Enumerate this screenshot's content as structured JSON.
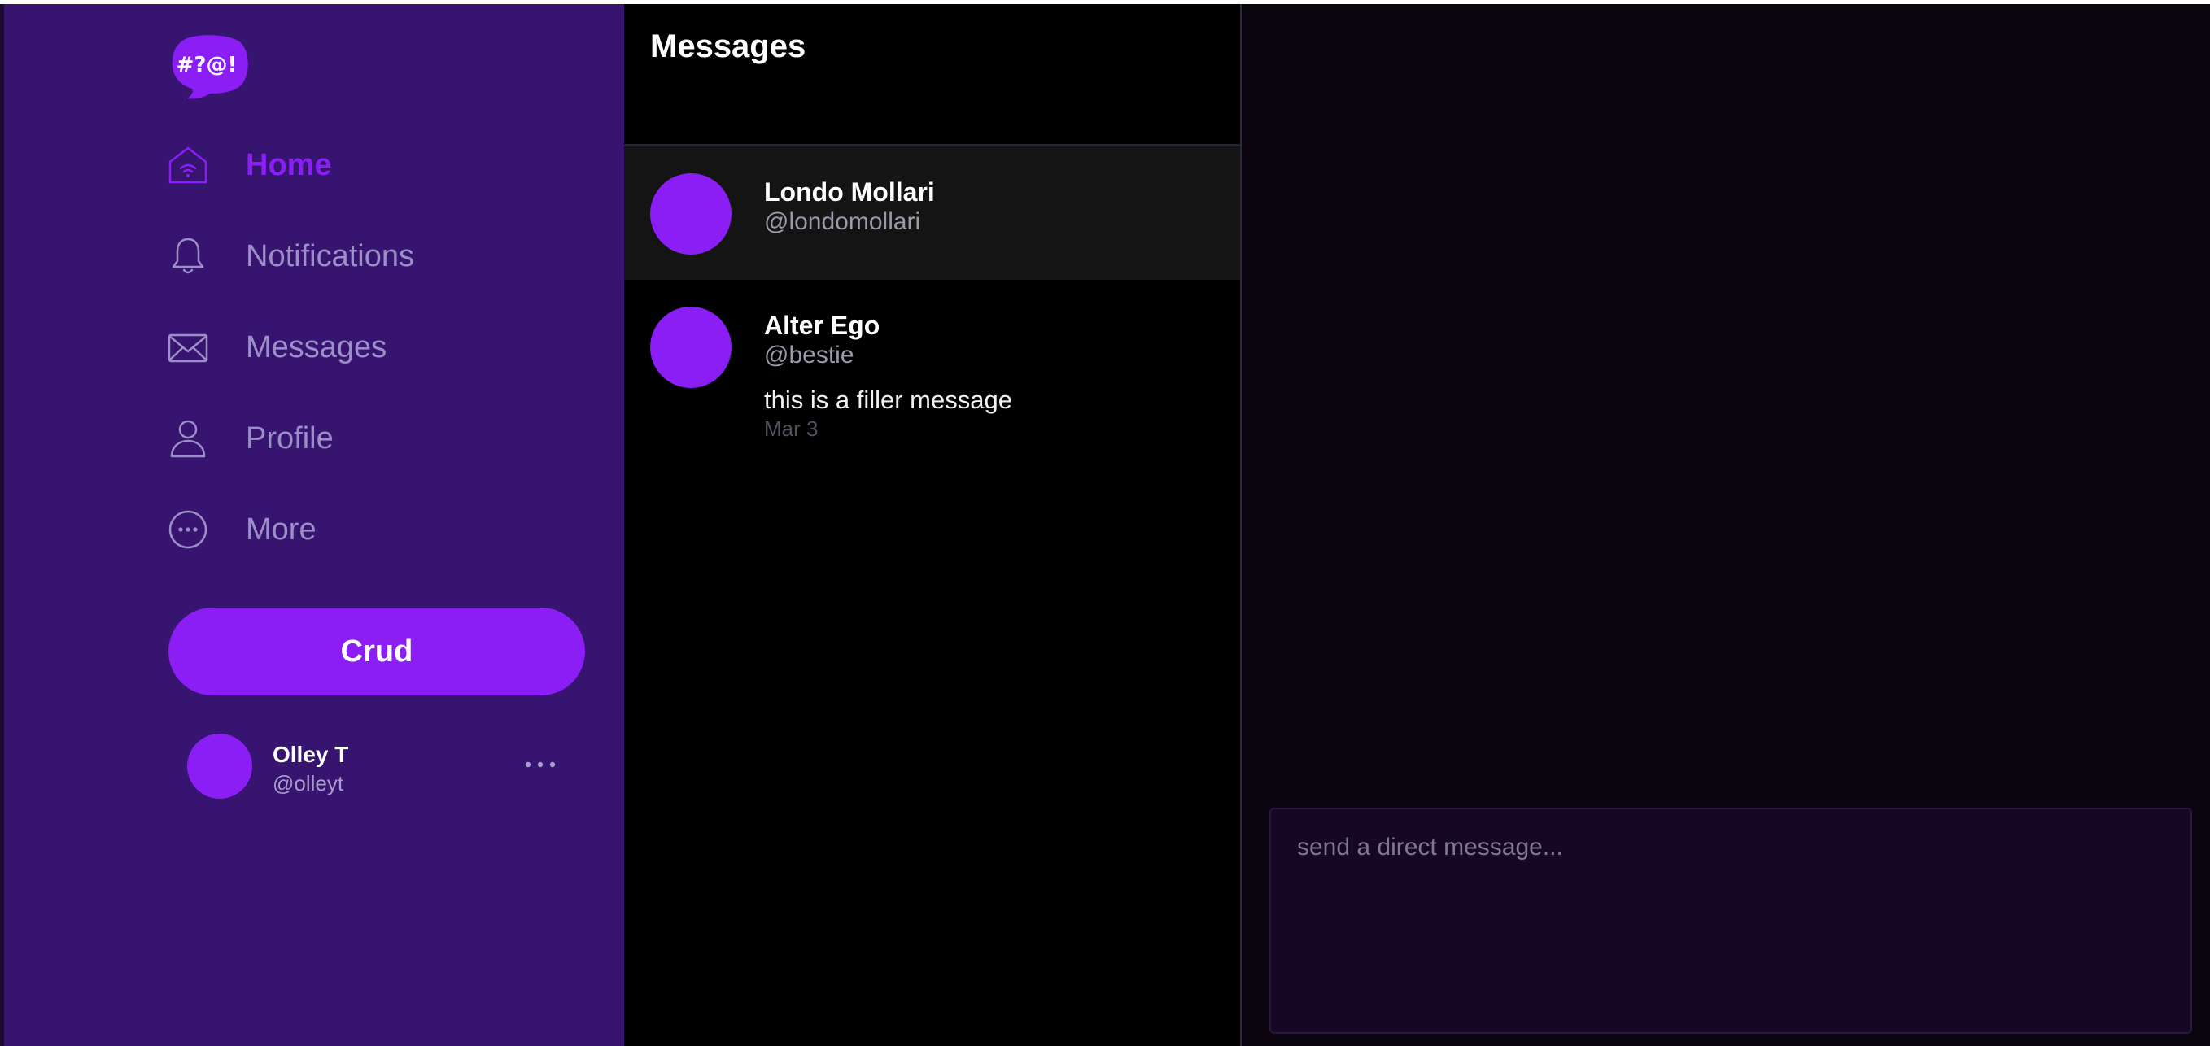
{
  "app": {
    "logo_text": "#?@!"
  },
  "sidebar": {
    "nav": [
      {
        "label": "Home",
        "icon": "home-icon",
        "active": true
      },
      {
        "label": "Notifications",
        "icon": "bell-icon",
        "active": false
      },
      {
        "label": "Messages",
        "icon": "envelope-icon",
        "active": false
      },
      {
        "label": "Profile",
        "icon": "person-icon",
        "active": false
      },
      {
        "label": "More",
        "icon": "more-circle-icon",
        "active": false
      }
    ],
    "crud_label": "Crud",
    "account": {
      "name": "Olley T",
      "handle": "@olleyt"
    }
  },
  "messages": {
    "title": "Messages",
    "conversations": [
      {
        "name": "Londo Mollari",
        "handle": "@londomollari",
        "preview": "",
        "date": "",
        "selected": true
      },
      {
        "name": "Alter Ego",
        "handle": "@bestie",
        "preview": "this is a filler message",
        "date": "Mar 3",
        "selected": false
      }
    ]
  },
  "chat": {
    "input_placeholder": "send a direct message..."
  },
  "colors": {
    "sidebar_bg": "#36146f",
    "accent": "#8a1ef5",
    "nav_inactive": "#9b8ec9",
    "chat_bg": "#0a040f"
  }
}
